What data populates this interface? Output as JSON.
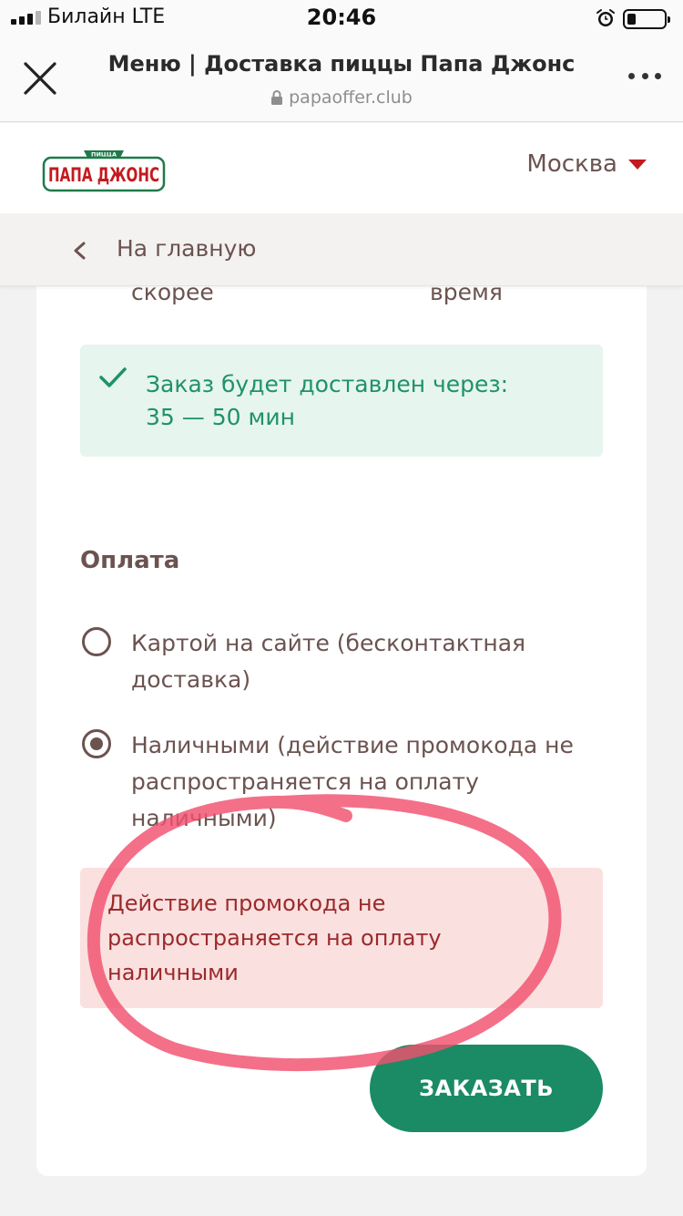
{
  "status_bar": {
    "carrier": "Билайн  LTE",
    "time": "20:46"
  },
  "browser": {
    "page_title": "Меню | Доставка пиццы Папа Джонс",
    "url": "papaoffer.club"
  },
  "site_header": {
    "logo_text": "ПАПА ДЖОНС",
    "logo_banner": "ПИЦЦА",
    "city": "Москва",
    "accent_color": "#c41a1e"
  },
  "nav": {
    "back_label": "На главную"
  },
  "delivery_time": {
    "option_left": "скорее",
    "option_right": "время"
  },
  "success": {
    "line1": "Заказ будет доставлен через:",
    "line2": "35 — 50 мин",
    "color": "#1f9268"
  },
  "payment": {
    "title": "Оплата",
    "options": [
      {
        "label": "Картой на сайте (бесконтактная доставка)",
        "selected": false
      },
      {
        "label": "Наличными (действие промокода не распространяется на оплату наличными)",
        "selected": true
      }
    ]
  },
  "error": {
    "text": "Действие промокода не распространяется на оплату наличными",
    "color": "#9b2a2a"
  },
  "order_button": {
    "label": "ЗАКАЗАТЬ",
    "color": "#1a8b65"
  },
  "annotation": {
    "shape": "hand-drawn circle",
    "color": "#f0506e"
  }
}
